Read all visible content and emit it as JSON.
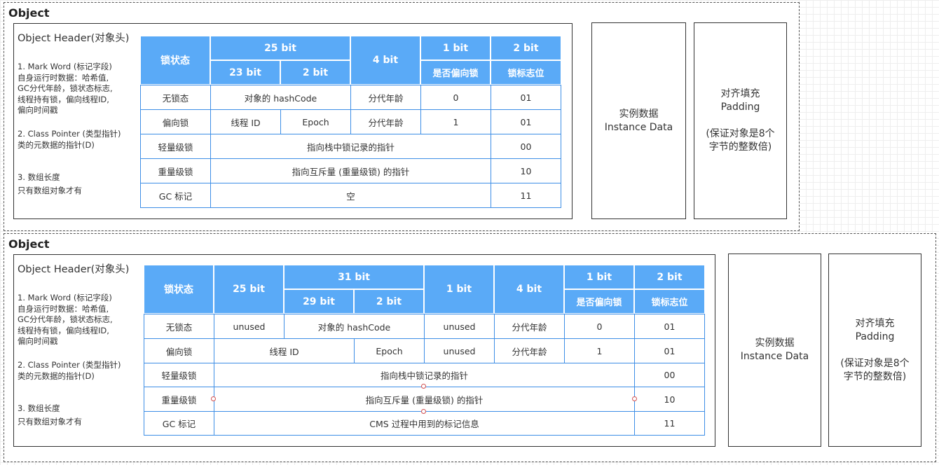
{
  "diagram1": {
    "title": "Object",
    "header_title": "Object Header(对象头)",
    "desc": {
      "mark_word": [
        "1. Mark Word (标记字段)",
        " 自身运行时数据：哈希值,",
        " GC分代年龄，锁状态标志,",
        " 线程持有锁，偏向线程ID,",
        " 偏向时间戳"
      ],
      "class_pointer": [
        "2. Class Pointer (类型指针)",
        " 类的元数据的指针(D)"
      ],
      "array_length": [
        "3. 数组长度",
        " 只有数组对象才有"
      ]
    },
    "table": {
      "header": {
        "lock_state": "锁状态",
        "bits_25": "25 bit",
        "bits_23": "23 bit",
        "bits_2": "2 bit",
        "bits_4": "4 bit",
        "bits_1": "1 bit",
        "is_biased": "是否偏向锁",
        "bits_2b": "2 bit",
        "lock_flag": "锁标志位"
      },
      "rows": {
        "unlocked": {
          "state": "无锁态",
          "hash": "对象的 hashCode",
          "age": "分代年龄",
          "biased": "0",
          "flag": "01"
        },
        "biased": {
          "state": "偏向锁",
          "thread": "线程 ID",
          "epoch": "Epoch",
          "age": "分代年龄",
          "biased": "1",
          "flag": "01"
        },
        "lightweight": {
          "state": "轻量级锁",
          "content": "指向栈中锁记录的指针",
          "flag": "00"
        },
        "heavyweight": {
          "state": "重量级锁",
          "content": "指向互斥量 (重量级锁) 的指针",
          "flag": "10"
        },
        "gc": {
          "state": "GC 标记",
          "content": "空",
          "flag": "11"
        }
      }
    },
    "instance_data": [
      "实例数据",
      "Instance Data"
    ],
    "padding": [
      "对齐填充",
      "Padding",
      "",
      "(保证对象是8个",
      "字节的整数倍)"
    ]
  },
  "diagram2": {
    "title": "Object",
    "header_title": "Object Header(对象头)",
    "desc": {
      "mark_word": [
        "1. Mark Word (标记字段)",
        " 自身运行时数据：哈希值,",
        " GC分代年龄，锁状态标志,",
        " 线程持有锁，偏向线程ID,",
        " 偏向时间戳"
      ],
      "class_pointer": [
        "2. Class Pointer (类型指针)",
        " 类的元数据的指针(D)"
      ],
      "array_length": [
        "3. 数组长度",
        " 只有数组对象才有"
      ]
    },
    "table": {
      "header": {
        "lock_state": "锁状态",
        "bits_25": "25 bit",
        "bits_31": "31 bit",
        "bits_29": "29 bit",
        "bits_2": "2 bit",
        "bits_1a": "1 bit",
        "bits_4": "4 bit",
        "bits_1b": "1 bit",
        "is_biased": "是否偏向锁",
        "bits_2b": "2 bit",
        "lock_flag": "锁标志位"
      },
      "rows": {
        "unlocked": {
          "state": "无锁态",
          "unused1": "unused",
          "hash": "对象的 hashCode",
          "unused2": "unused",
          "age": "分代年龄",
          "biased": "0",
          "flag": "01"
        },
        "biased": {
          "state": "偏向锁",
          "thread": "线程 ID",
          "epoch": "Epoch",
          "unused": "unused",
          "age": "分代年龄",
          "biased": "1",
          "flag": "01"
        },
        "lightweight": {
          "state": "轻量级锁",
          "content": "指向栈中锁记录的指针",
          "flag": "00"
        },
        "heavyweight": {
          "state": "重量级锁",
          "content": "指向互斥量 (重量级锁) 的指针",
          "flag": "10"
        },
        "gc": {
          "state": "GC 标记",
          "content": "CMS 过程中用到的标记信息",
          "flag": "11"
        }
      }
    },
    "instance_data": [
      "实例数据",
      "Instance Data"
    ],
    "padding": [
      "对齐填充",
      "Padding",
      "",
      "(保证对象是8个",
      "字节的整数倍)"
    ]
  }
}
